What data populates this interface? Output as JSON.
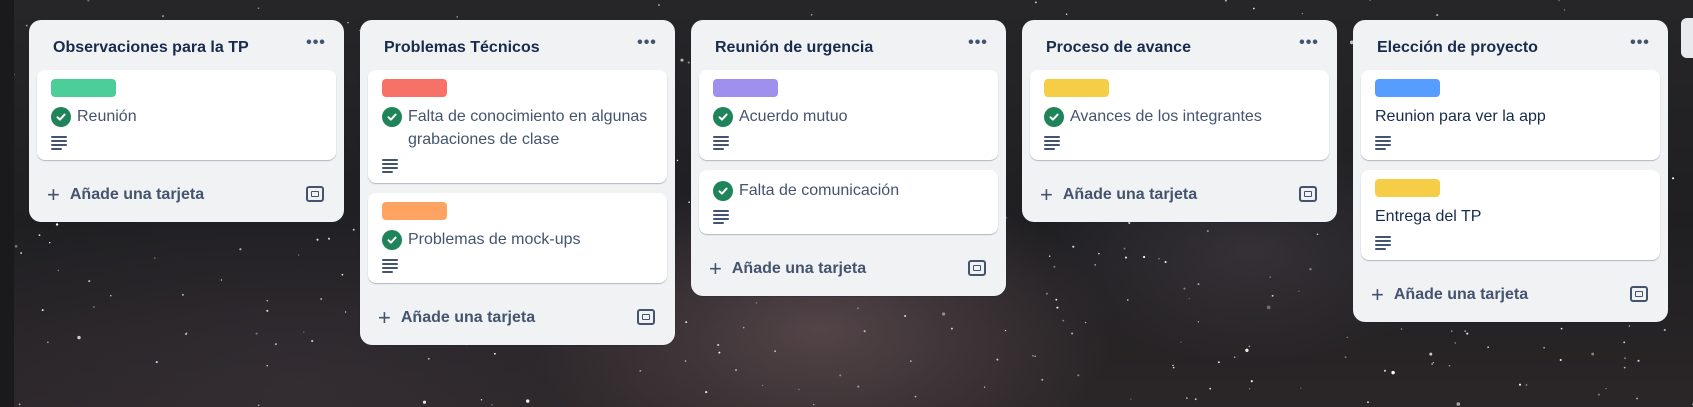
{
  "board": {
    "add_card_label": "Añade una tarjeta",
    "list_menu_icon": "more-horizontal-icon",
    "template_icon": "card-template-icon",
    "description_icon": "description-lines-icon",
    "check_icon": "checkmark-circle-icon",
    "colors": {
      "list_bg": "#f1f2f4",
      "card_bg": "#ffffff",
      "check_green": "#1f845a",
      "text_dark": "#172b4d",
      "text_muted": "#44546f"
    },
    "lists": [
      {
        "title": "Observaciones para la TP",
        "cards": [
          {
            "label_color": "#4bce97",
            "done": true,
            "title": "Reunión",
            "has_description": true
          }
        ]
      },
      {
        "title": "Problemas Técnicos",
        "cards": [
          {
            "label_color": "#f87168",
            "done": true,
            "title": "Falta de conocimiento en algunas grabaciones de clase",
            "has_description": true
          },
          {
            "label_color": "#fea362",
            "done": true,
            "title": "Problemas de mock-ups",
            "has_description": true
          }
        ]
      },
      {
        "title": "Reunión de urgencia",
        "cards": [
          {
            "label_color": "#9f8fef",
            "done": true,
            "title": "Acuerdo mutuo",
            "has_description": true
          },
          {
            "label_color": null,
            "done": true,
            "title": "Falta de comunicación",
            "has_description": true
          }
        ]
      },
      {
        "title": "Proceso de avance",
        "cards": [
          {
            "label_color": "#f5cd47",
            "done": true,
            "title": "Avances de los integrantes",
            "has_description": true
          }
        ]
      },
      {
        "title": "Elección de proyecto",
        "cards": [
          {
            "label_color": "#579dff",
            "done": false,
            "title": "Reunion para ver la app",
            "has_description": true
          },
          {
            "label_color": "#f5cd47",
            "done": false,
            "title": "Entrega del TP",
            "has_description": true
          }
        ]
      }
    ]
  }
}
